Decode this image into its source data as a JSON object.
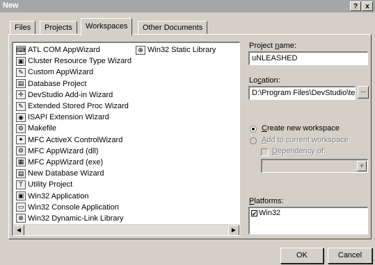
{
  "window": {
    "title": "New",
    "help_label": "?",
    "close_label": "x"
  },
  "tabs": [
    {
      "label": "Files"
    },
    {
      "label": "Projects"
    },
    {
      "label": "Workspaces"
    },
    {
      "label": "Other Documents"
    }
  ],
  "active_tab": "Projects",
  "project_types": {
    "column1": [
      {
        "label": "ATL COM AppWizard",
        "icon": "atl-icon",
        "glyph": "⌨"
      },
      {
        "label": "Cluster Resource Type Wizard",
        "icon": "cluster-icon",
        "glyph": "▣"
      },
      {
        "label": "Custom AppWizard",
        "icon": "custom-wizard-icon",
        "glyph": "✎"
      },
      {
        "label": "Database Project",
        "icon": "database-icon",
        "glyph": "▤"
      },
      {
        "label": "DevStudio Add-in Wizard",
        "icon": "addin-icon",
        "glyph": "✢"
      },
      {
        "label": "Extended Stored Proc Wizard",
        "icon": "stored-proc-icon",
        "glyph": "✎"
      },
      {
        "label": "ISAPI Extension Wizard",
        "icon": "isapi-icon",
        "glyph": "◉"
      },
      {
        "label": "Makefile",
        "icon": "makefile-icon",
        "glyph": "⚙"
      },
      {
        "label": "MFC ActiveX ControlWizard",
        "icon": "activex-icon",
        "glyph": "✦"
      },
      {
        "label": "MFC AppWizard (dll)",
        "icon": "mfc-dll-icon",
        "glyph": "⚙"
      },
      {
        "label": "MFC AppWizard (exe)",
        "icon": "mfc-exe-icon",
        "glyph": "▦"
      },
      {
        "label": "New Database Wizard",
        "icon": "new-database-icon",
        "glyph": "▤"
      },
      {
        "label": "Utility Project",
        "icon": "utility-icon",
        "glyph": "T"
      },
      {
        "label": "Win32 Application",
        "icon": "win32-app-icon",
        "glyph": "▣"
      },
      {
        "label": "Win32 Console Application",
        "icon": "console-icon",
        "glyph": "▭"
      },
      {
        "label": "Win32 Dynamic-Link Library",
        "icon": "dll-icon",
        "glyph": "⊕"
      }
    ],
    "column2": [
      {
        "label": "Win32 Static Library",
        "icon": "static-library-icon",
        "glyph": "⊕"
      }
    ]
  },
  "scrollbar": {
    "left_arrow": "◀",
    "right_arrow": "▶"
  },
  "project_name": {
    "label_pre": "Project ",
    "label_ul": "n",
    "label_post": "ame:",
    "value": "uNLEASHED"
  },
  "location": {
    "label_pre": "Lo",
    "label_ul": "c",
    "label_post": "ation:",
    "value": "D:\\Program Files\\DevStudio\\tes",
    "browse_label": "..."
  },
  "workspace_options": {
    "create_new": {
      "label_ul": "C",
      "label_post": "reate new workspace",
      "selected": true
    },
    "add_current": {
      "label_ul": "A",
      "label_post": "dd to current workspace",
      "enabled": false
    },
    "dependency": {
      "label_ul": "D",
      "label_post": "ependency of:",
      "enabled": false
    }
  },
  "platforms": {
    "label_pre": "",
    "label_ul": "P",
    "label_post": "latforms:",
    "items": [
      {
        "label": "Win32",
        "checked": true
      }
    ]
  },
  "buttons": {
    "ok": "OK",
    "cancel": "Cancel"
  },
  "colors": {
    "face": "#d4d0c8",
    "title_bar": "#a6a6a6",
    "shadow": "#808080",
    "highlight": "#ffffff"
  }
}
